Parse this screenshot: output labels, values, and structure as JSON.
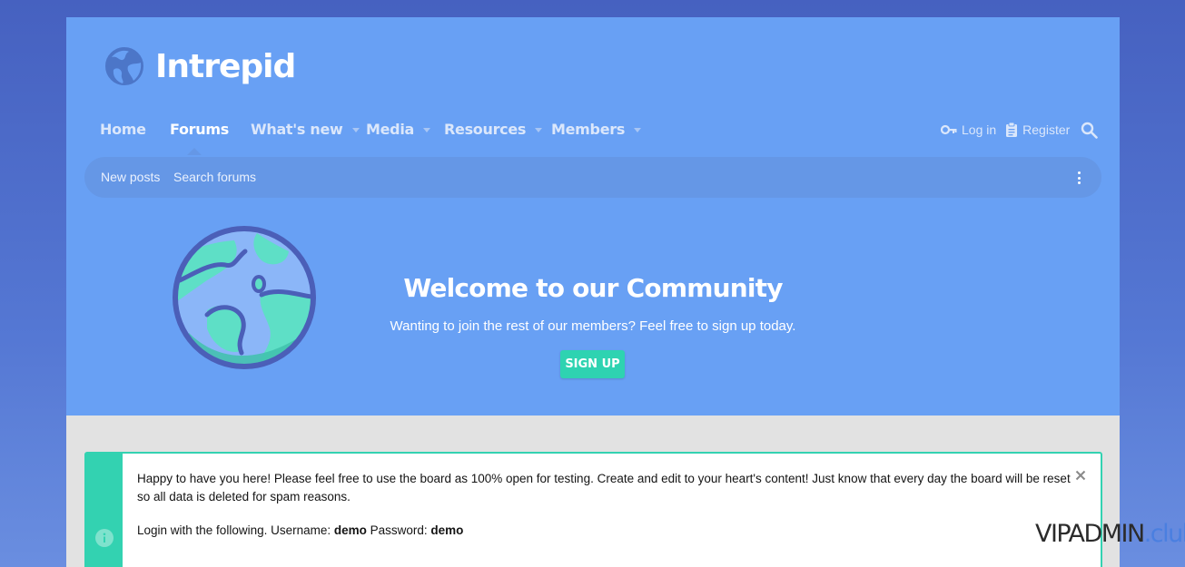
{
  "site": {
    "logo_text": "Intrepid"
  },
  "nav": {
    "items": [
      {
        "label": "Home",
        "has_dropdown": false,
        "active": false
      },
      {
        "label": "Forums",
        "has_dropdown": false,
        "active": true
      },
      {
        "label": "What's new",
        "has_dropdown": true,
        "active": false
      },
      {
        "label": "Media",
        "has_dropdown": true,
        "active": false
      },
      {
        "label": "Resources",
        "has_dropdown": true,
        "active": false
      },
      {
        "label": "Members",
        "has_dropdown": true,
        "active": false
      }
    ],
    "login_label": "Log in",
    "register_label": "Register",
    "login_icon": "key-icon",
    "register_icon": "clipboard-icon",
    "search_icon": "search-icon"
  },
  "subnav": {
    "items": [
      "New posts",
      "Search forums"
    ],
    "menu_icon": "kebab-menu-icon"
  },
  "hero": {
    "title": "Welcome to our Community",
    "subtitle": "Wanting to join the rest of our members? Feel free to sign up today.",
    "button_label": "SIGN UP"
  },
  "notice": {
    "line1": "Happy to have you here! Please feel free to use the board as 100% open for testing. Create and edit to your heart's content! Just know that every day the board will be reset so all data is deleted for spam reasons.",
    "login_prefix": "Login with the following. Username: ",
    "username": "demo",
    "password_label": " Password: ",
    "password": "demo",
    "icon": "info-icon",
    "close_icon": "close-icon"
  },
  "watermark": {
    "main": "VIPADMIN",
    "suffix": ".club"
  },
  "colors": {
    "page_bg": "#4a66c6",
    "header_bg": "#68a0f4",
    "subnav_bg": "#6597e6",
    "accent": "#33d2b1",
    "content_bg": "#e2e2e2"
  }
}
